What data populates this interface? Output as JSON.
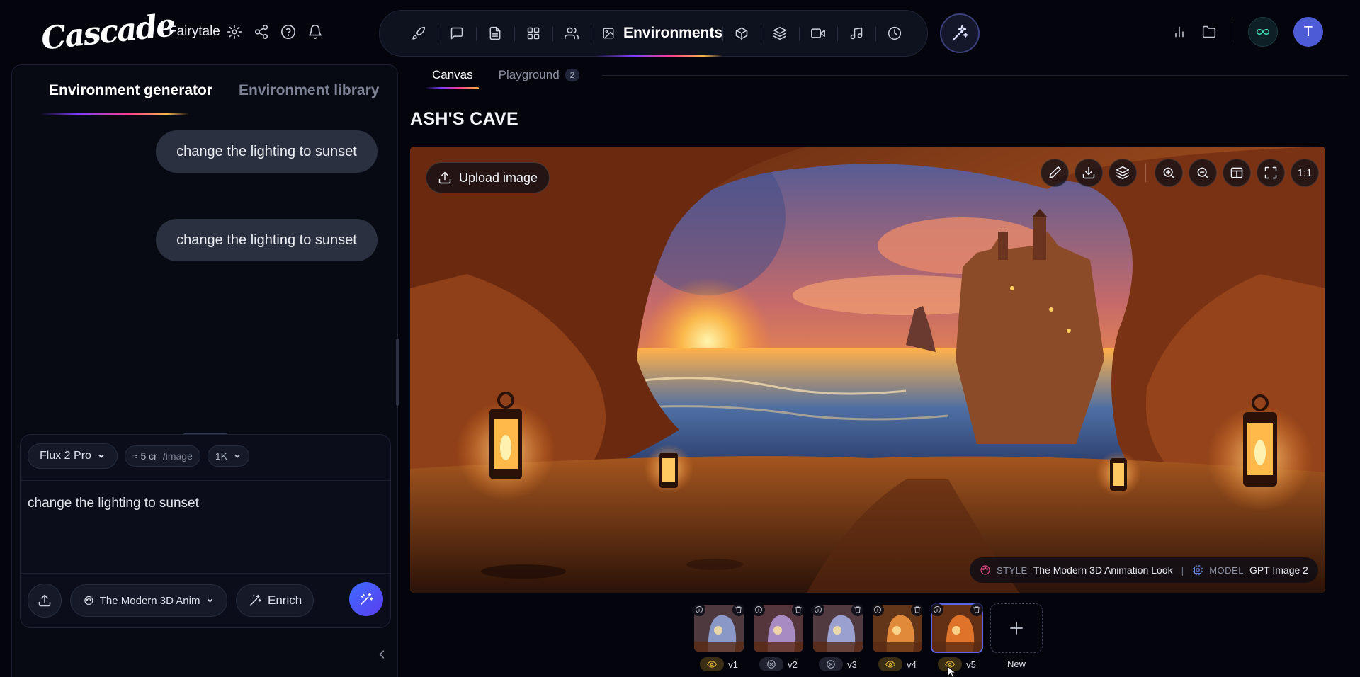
{
  "app": {
    "logo_text": "Cascade",
    "project_name": "Fairytale"
  },
  "nav": {
    "active_label": "Environments",
    "items": [
      "rocket-icon",
      "chat-icon",
      "document-icon",
      "grid-icon",
      "people-icon",
      "image-icon",
      "cube-icon",
      "layers-icon",
      "video-icon",
      "music-icon",
      "clock-icon"
    ]
  },
  "user": {
    "avatar_initial": "T"
  },
  "left_panel": {
    "tabs": [
      "Environment generator",
      "Environment library"
    ],
    "active_tab": "Environment generator",
    "messages": [
      "change the lighting to sunset",
      "change the lighting to sunset"
    ],
    "composer": {
      "model": "Flux 2 Pro",
      "cost": "≈ 5 cr",
      "cost_unit": "/image",
      "resolution": "1K",
      "prompt": "change the lighting to sunset",
      "style": "The Modern 3D Anim...",
      "enrich_label": "Enrich"
    }
  },
  "canvas": {
    "tabs": [
      {
        "label": "Canvas",
        "active": true
      },
      {
        "label": "Playground",
        "count": "2"
      }
    ],
    "title": "ASH'S CAVE",
    "upload_label": "Upload image",
    "zoom_label": "1:1",
    "meta": {
      "style_key": "STYLE",
      "style_value": "The Modern 3D Animation Look",
      "model_key": "MODEL",
      "model_value": "GPT Image 2"
    }
  },
  "versions": [
    {
      "label": "v1",
      "state": "visible"
    },
    {
      "label": "v2",
      "state": "hidden"
    },
    {
      "label": "v3",
      "state": "hidden"
    },
    {
      "label": "v4",
      "state": "visible"
    },
    {
      "label": "v5",
      "state": "visible",
      "current": true
    }
  ],
  "new_version_label": "New",
  "colors": {
    "accent": "#5d63e8",
    "background": "#03040c",
    "visible_flag": "#e8b63e",
    "infinity": "#3fe0b6"
  }
}
